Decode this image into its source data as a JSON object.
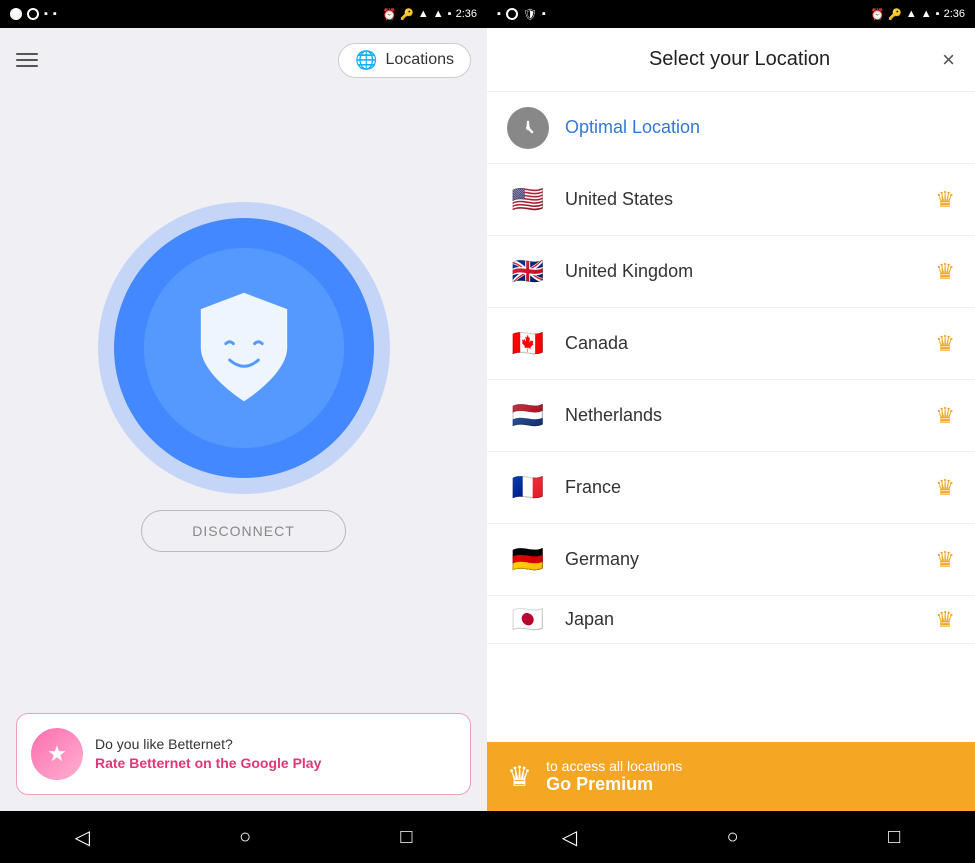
{
  "left": {
    "statusBar": {
      "time": "2:36"
    },
    "nav": {
      "locationsBtn": "Locations"
    },
    "disconnect": {
      "label": "DISCONNECT"
    },
    "rating": {
      "title": "Do you like Betternet?",
      "linkText": "Rate Betternet on the Google Play"
    }
  },
  "right": {
    "statusBar": {
      "time": "2:36"
    },
    "header": {
      "title": "Select your Location",
      "closeLabel": "×"
    },
    "locations": [
      {
        "id": "optimal",
        "name": "Optimal Location",
        "flag": "⊙",
        "premium": false
      },
      {
        "id": "us",
        "name": "United States",
        "flag": "🇺🇸",
        "premium": true
      },
      {
        "id": "uk",
        "name": "United Kingdom",
        "flag": "🇬🇧",
        "premium": true
      },
      {
        "id": "ca",
        "name": "Canada",
        "flag": "🇨🇦",
        "premium": true
      },
      {
        "id": "nl",
        "name": "Netherlands",
        "flag": "🇳🇱",
        "premium": true
      },
      {
        "id": "fr",
        "name": "France",
        "flag": "🇫🇷",
        "premium": true
      },
      {
        "id": "de",
        "name": "Germany",
        "flag": "🇩🇪",
        "premium": true
      },
      {
        "id": "jp",
        "name": "Japan",
        "flag": "🇯🇵",
        "premium": true
      }
    ],
    "premium": {
      "subtitle": "to access all locations",
      "title": "Go Premium"
    }
  },
  "bottomNav": {
    "back": "◁",
    "home": "○",
    "recent": "□"
  },
  "colors": {
    "accent": "#4488ff",
    "crown": "#f5a623",
    "optimal": "#3377dd",
    "ratingPink": "#e0367a",
    "premiumBg": "#f5a623"
  }
}
